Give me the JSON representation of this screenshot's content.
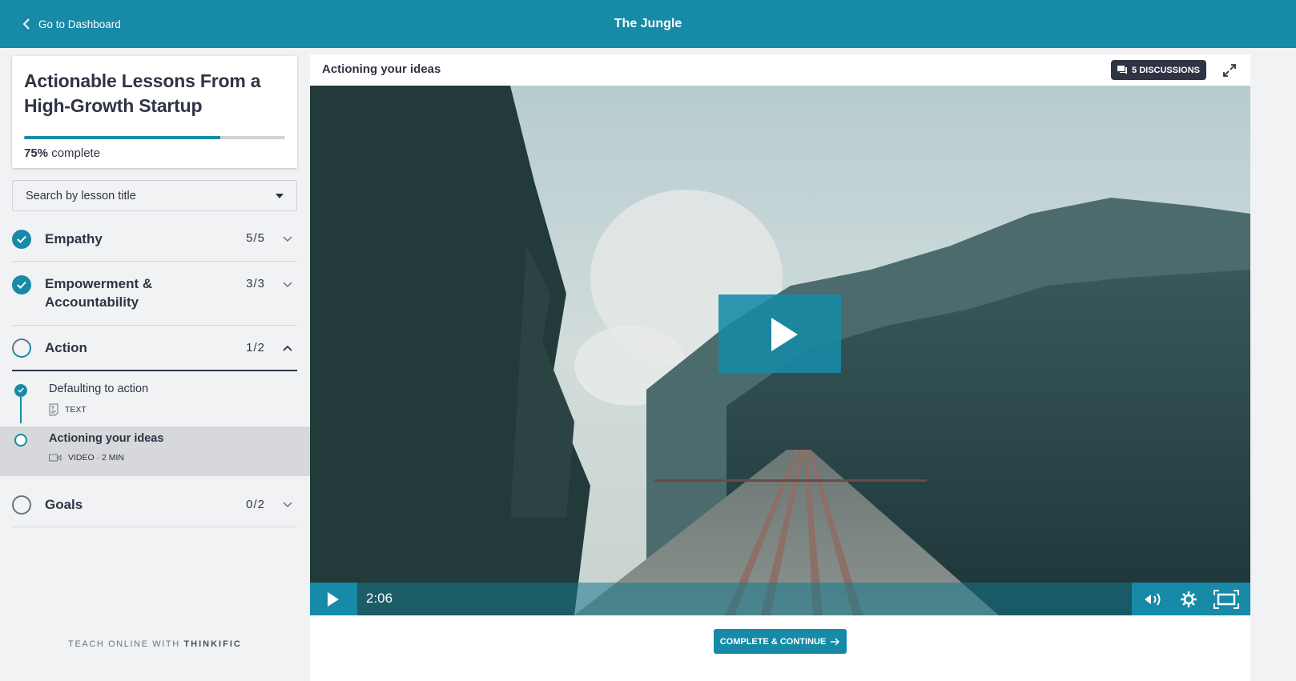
{
  "topbar": {
    "back_label": "Go to Dashboard",
    "brand": "The Jungle"
  },
  "sidebar": {
    "course_title": "Actionable Lessons From a High-Growth Startup",
    "progress_percent": 75,
    "progress_value_label": "75%",
    "progress_suffix": "complete",
    "search_placeholder": "Search by lesson title",
    "chapters": [
      {
        "title": "Empathy",
        "count": "5/5",
        "status": "complete",
        "expanded": false
      },
      {
        "title": "Empowerment & Accountability",
        "count": "3/3",
        "status": "complete",
        "expanded": false
      },
      {
        "title": "Action",
        "count": "1/2",
        "status": "in-progress",
        "expanded": true
      },
      {
        "title": "Goals",
        "count": "0/2",
        "status": "not-started",
        "expanded": false
      }
    ],
    "lessons": [
      {
        "title": "Defaulting to action",
        "meta": "TEXT",
        "type": "text",
        "status": "complete",
        "active": false
      },
      {
        "title": "Actioning your ideas",
        "meta": "VIDEO · 2 MIN",
        "type": "video",
        "status": "current",
        "active": true
      }
    ],
    "footer_prefix": "TEACH ONLINE WITH",
    "footer_brand": "THINKIFIC"
  },
  "content": {
    "lesson_title": "Actioning your ideas",
    "discussions_label": "5 DISCUSSIONS",
    "video": {
      "time": "2:06"
    },
    "complete_label": "COMPLETE & CONTINUE"
  },
  "colors": {
    "brand": "#168aa6",
    "text_dark": "#2f3445",
    "sidebar_bg": "#f1f2f4"
  }
}
